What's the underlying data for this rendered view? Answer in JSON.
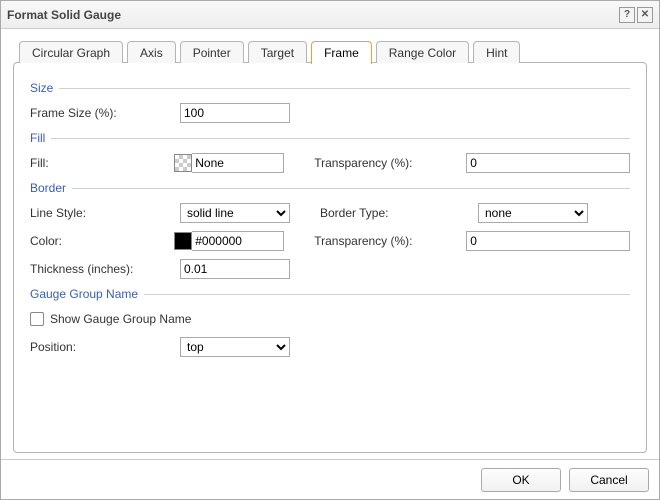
{
  "title": "Format Solid Gauge",
  "tabs": [
    {
      "label": "Circular Graph"
    },
    {
      "label": "Axis"
    },
    {
      "label": "Pointer"
    },
    {
      "label": "Target"
    },
    {
      "label": "Frame"
    },
    {
      "label": "Range Color"
    },
    {
      "label": "Hint"
    }
  ],
  "active_tab": "Frame",
  "groups": {
    "size": {
      "title": "Size",
      "frame_size_label": "Frame Size (%):",
      "frame_size_value": "100"
    },
    "fill": {
      "title": "Fill",
      "fill_label": "Fill:",
      "fill_value": "None",
      "transparency_label": "Transparency (%):",
      "transparency_value": "0"
    },
    "border": {
      "title": "Border",
      "line_style_label": "Line Style:",
      "line_style_value": "solid line",
      "border_type_label": "Border Type:",
      "border_type_value": "none",
      "color_label": "Color:",
      "color_value": "#000000",
      "transparency_label": "Transparency (%):",
      "transparency_value": "0",
      "thickness_label": "Thickness (inches):",
      "thickness_value": "0.01"
    },
    "gauge_group": {
      "title": "Gauge Group Name",
      "show_label": "Show Gauge Group Name",
      "show_checked": false,
      "position_label": "Position:",
      "position_value": "top"
    }
  },
  "buttons": {
    "ok": "OK",
    "cancel": "Cancel"
  },
  "titlebar": {
    "help_glyph": "?",
    "close_glyph": "✕"
  }
}
